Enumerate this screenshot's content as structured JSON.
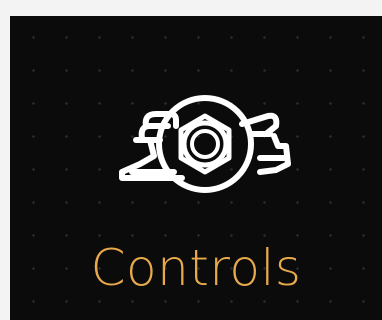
{
  "tile": {
    "label": "Controls",
    "icon": "controls-valve-icon"
  },
  "colors": {
    "tile_background": "#0b0b0b",
    "label": "#e8a94c",
    "icon": "#ffffff",
    "page_background": "#f3f3f3"
  }
}
